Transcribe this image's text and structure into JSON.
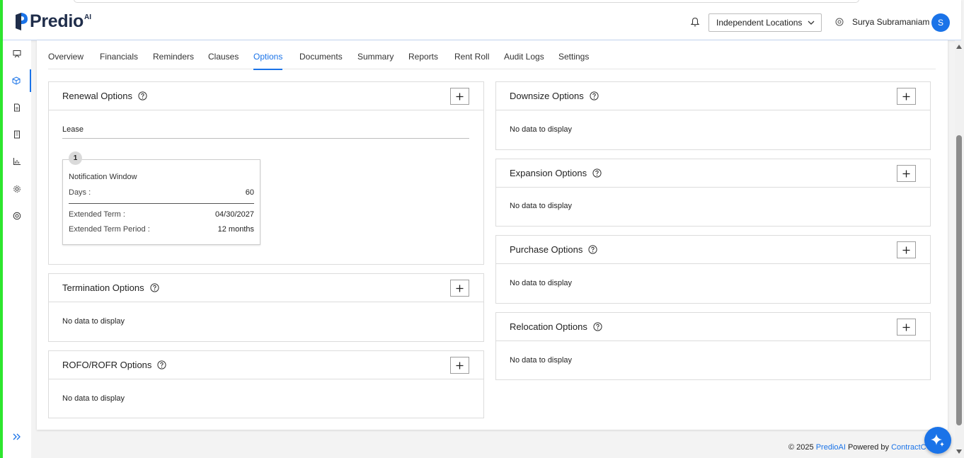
{
  "brand": {
    "name": "Predio",
    "sup": "AI"
  },
  "header": {
    "location": "Independent Locations",
    "user_name": "Surya Subramaniam",
    "avatar_initial": "S"
  },
  "colors": {
    "accent": "#1a73e8",
    "edge": "#2ee62e",
    "logo_dark": "#1f2d4a"
  },
  "sidebar": {
    "items": [
      {
        "icon": "presentation-icon",
        "active": false
      },
      {
        "icon": "cube-icon",
        "active": true
      },
      {
        "icon": "document-icon",
        "active": false
      },
      {
        "icon": "building-icon",
        "active": false
      },
      {
        "icon": "chart-icon",
        "active": false
      },
      {
        "icon": "gear-icon",
        "active": false
      },
      {
        "icon": "support-icon",
        "active": false
      }
    ],
    "expand_icon": "double-chevron-right-icon"
  },
  "tabs": [
    "Overview",
    "Financials",
    "Reminders",
    "Clauses",
    "Options",
    "Documents",
    "Summary",
    "Reports",
    "Rent Roll",
    "Audit Logs",
    "Settings"
  ],
  "active_tab": "Options",
  "cards": {
    "renewal": {
      "title": "Renewal Options",
      "lease_label": "Lease",
      "item": {
        "number": "1",
        "title": "Notification Window",
        "days_label": "Days :",
        "days_value": "60",
        "extended_term_label": "Extended Term :",
        "extended_term_value": "04/30/2027",
        "extended_period_label": "Extended Term Period :",
        "extended_period_value": "12 months"
      }
    },
    "termination": {
      "title": "Termination Options",
      "empty": "No data to display"
    },
    "rofo": {
      "title": "ROFO/ROFR Options",
      "empty": "No data to display"
    },
    "downsize": {
      "title": "Downsize Options",
      "empty": "No data to display"
    },
    "expansion": {
      "title": "Expansion Options",
      "empty": "No data to display"
    },
    "purchase": {
      "title": "Purchase Options",
      "empty": "No data to display"
    },
    "relocation": {
      "title": "Relocation Options",
      "empty": "No data to display"
    }
  },
  "footer": {
    "copyright": "© 2025 ",
    "brand_link": "PredioAI",
    "powered_by": " Powered by ",
    "powered_link": "ContractC"
  }
}
